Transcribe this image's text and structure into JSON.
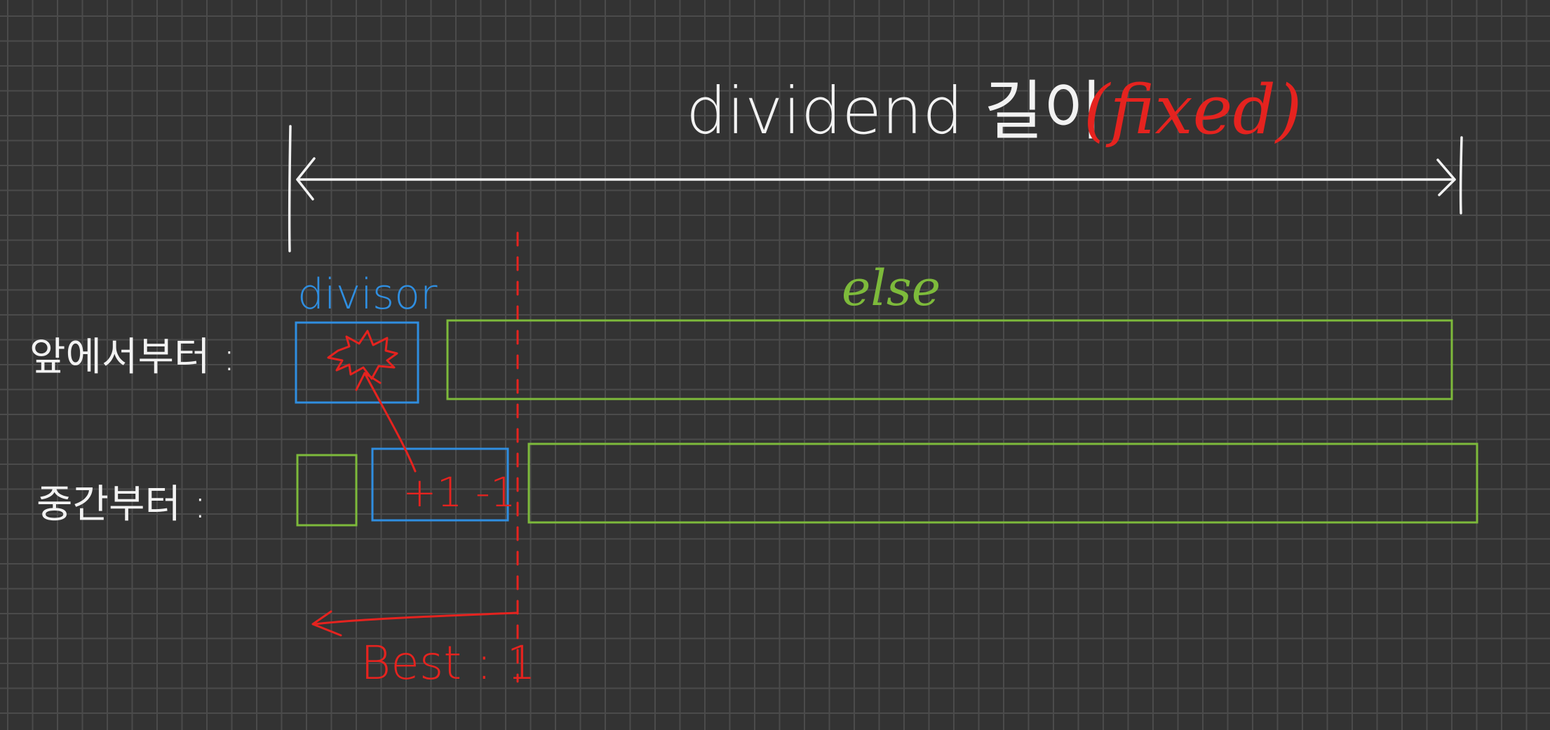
{
  "title": {
    "prefix": "dividend 길이",
    "suffix": "(fixed)"
  },
  "labels": {
    "divisor": "divisor",
    "else": "else",
    "row_front": "앞에서부터 :",
    "row_middle": "중간부터 :",
    "offset": "+1 -1",
    "best": "Best : 1"
  },
  "colors": {
    "background": "#333333",
    "grid": "#4b4b4b",
    "ink_white": "#f2f2f2",
    "ink_red": "#e5231f",
    "ink_blue": "#2f8ee0",
    "ink_green": "#7dba3b"
  }
}
